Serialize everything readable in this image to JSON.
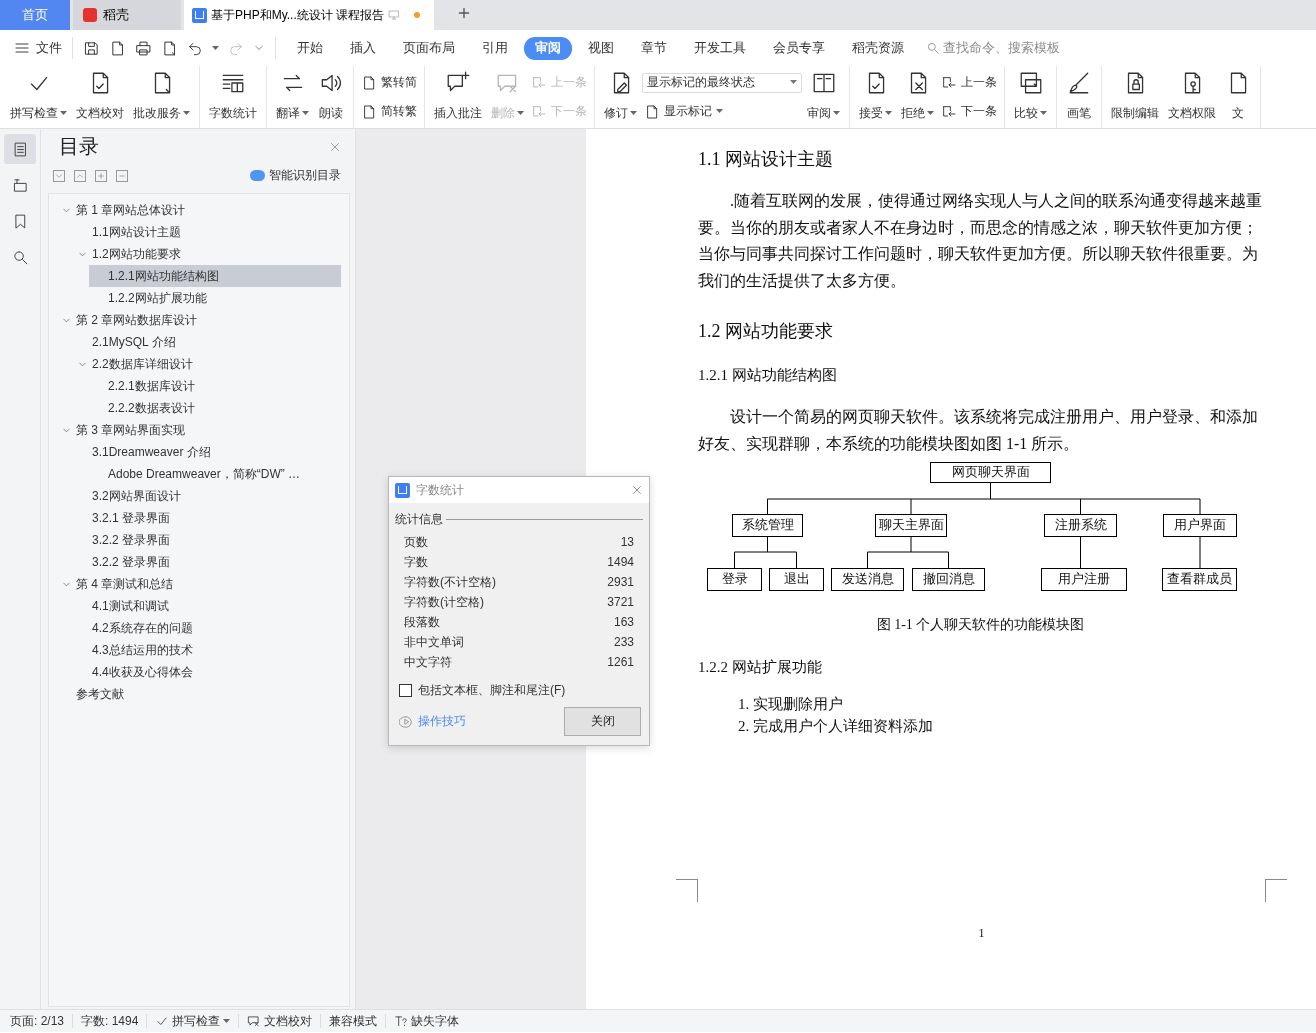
{
  "tabs": [
    {
      "kind": "home",
      "label": "首页",
      "selected": false
    },
    {
      "kind": "app",
      "label": "稻壳",
      "selected": false
    },
    {
      "kind": "document",
      "label": "基于PHP和My...统设计 课程报告",
      "selected": true,
      "modified": true
    }
  ],
  "menu": {
    "file": "文件",
    "tabs": [
      {
        "label": "开始",
        "selected": false
      },
      {
        "label": "插入",
        "selected": false
      },
      {
        "label": "页面布局",
        "selected": false
      },
      {
        "label": "引用",
        "selected": false
      },
      {
        "label": "审阅",
        "selected": true
      },
      {
        "label": "视图",
        "selected": false
      },
      {
        "label": "章节",
        "selected": false
      },
      {
        "label": "开发工具",
        "selected": false
      },
      {
        "label": "会员专享",
        "selected": false
      },
      {
        "label": "稻壳资源",
        "selected": false
      }
    ],
    "search": {
      "placeholder": "查找命令、搜索模板"
    }
  },
  "ribbon": {
    "groups": [
      {
        "items": [
          {
            "kind": "large",
            "label": "拼写检查",
            "menu": true,
            "disabled": false
          },
          {
            "kind": "large",
            "label": "文档校对",
            "menu": false,
            "disabled": false
          },
          {
            "kind": "large",
            "label": "批改服务",
            "menu": true,
            "disabled": false
          }
        ]
      },
      {
        "items": [
          {
            "kind": "large",
            "label": "字数统计",
            "menu": false,
            "disabled": false
          }
        ]
      },
      {
        "items": [
          {
            "kind": "large",
            "label": "翻译",
            "menu": true,
            "disabled": false
          },
          {
            "kind": "large",
            "label": "朗读",
            "menu": false,
            "disabled": false
          }
        ]
      },
      {
        "items": [
          {
            "kind": "stack",
            "items": [
              {
                "kind": "small",
                "label": "繁转简",
                "menu": false,
                "disabled": false
              },
              {
                "kind": "small",
                "label": "简转繁",
                "menu": false,
                "disabled": false
              }
            ]
          }
        ]
      },
      {
        "items": [
          {
            "kind": "large",
            "label": "插入批注",
            "menu": false,
            "disabled": false
          },
          {
            "kind": "large",
            "label": "删除",
            "menu": true,
            "disabled": true
          },
          {
            "kind": "stack",
            "items": [
              {
                "kind": "small",
                "label": "上一条",
                "menu": false,
                "disabled": true
              },
              {
                "kind": "small",
                "label": "下一条",
                "menu": false,
                "disabled": true
              }
            ]
          }
        ]
      },
      {
        "items": [
          {
            "kind": "large",
            "label": "修订",
            "menu": true,
            "disabled": false
          },
          {
            "kind": "stack",
            "items": [
              {
                "kind": "select",
                "value": "显示标记的最终状态"
              },
              {
                "kind": "small",
                "label": "显示标记",
                "menu": true,
                "disabled": false
              }
            ]
          },
          {
            "kind": "large",
            "label": "审阅",
            "menu": true,
            "disabled": false
          }
        ]
      },
      {
        "items": [
          {
            "kind": "large",
            "label": "接受",
            "menu": true,
            "disabled": false
          },
          {
            "kind": "large",
            "label": "拒绝",
            "menu": true,
            "disabled": false
          },
          {
            "kind": "stack",
            "items": [
              {
                "kind": "small",
                "label": "上一条",
                "menu": false,
                "disabled": false
              },
              {
                "kind": "small",
                "label": "下一条",
                "menu": false,
                "disabled": false
              }
            ]
          }
        ]
      },
      {
        "items": [
          {
            "kind": "large",
            "label": "比较",
            "menu": true,
            "disabled": false
          }
        ]
      },
      {
        "items": [
          {
            "kind": "large",
            "label": "画笔",
            "menu": false,
            "disabled": false
          }
        ]
      },
      {
        "items": [
          {
            "kind": "large",
            "label": "限制编辑",
            "menu": false,
            "disabled": false
          },
          {
            "kind": "large",
            "label": "文档权限",
            "menu": false,
            "disabled": false
          },
          {
            "kind": "large",
            "label": "文",
            "menu": false,
            "disabled": false
          }
        ]
      }
    ]
  },
  "side_rail": [
    {
      "selected": true
    },
    {
      "selected": false
    },
    {
      "selected": false
    },
    {
      "selected": false
    }
  ],
  "toc": {
    "title": "目录",
    "smart_button": "智能识别目录",
    "items": [
      {
        "label": "第 1 章网站总体设计",
        "expanded": true,
        "selected": false,
        "children": [
          {
            "label": "1.1网站设计主题",
            "expanded": false,
            "selected": false
          },
          {
            "label": "1.2网站功能要求",
            "expanded": true,
            "selected": false,
            "children": [
              {
                "label": "1.2.1网站功能结构图",
                "expanded": false,
                "selected": true
              },
              {
                "label": "1.2.2网站扩展功能",
                "expanded": false,
                "selected": false
              }
            ]
          }
        ]
      },
      {
        "label": "第 2 章网站数据库设计",
        "expanded": true,
        "selected": false,
        "children": [
          {
            "label": "2.1MySQL 介绍",
            "expanded": false,
            "selected": false
          },
          {
            "label": "2.2数据库详细设计",
            "expanded": true,
            "selected": false,
            "children": [
              {
                "label": "2.2.1数据库设计",
                "expanded": false,
                "selected": false
              },
              {
                "label": "2.2.2数据表设计",
                "expanded": false,
                "selected": false
              }
            ]
          }
        ]
      },
      {
        "label": "第 3 章网站界面实现",
        "expanded": true,
        "selected": false,
        "children": [
          {
            "label": "3.1Dreamweaver 介绍",
            "expanded": false,
            "selected": false,
            "children": [
              {
                "label": "Adobe Dreamweaver，简称“DW” …",
                "expanded": false,
                "selected": false
              }
            ]
          },
          {
            "label": "3.2网站界面设计",
            "expanded": false,
            "selected": false
          },
          {
            "label": "3.2.1  登录界面",
            "expanded": false,
            "selected": false
          },
          {
            "label": "3.2.2  登录界面",
            "expanded": false,
            "selected": false
          },
          {
            "label": "3.2.2  登录界面",
            "expanded": false,
            "selected": false
          }
        ]
      },
      {
        "label": "第 4 章测试和总结",
        "expanded": true,
        "selected": false,
        "children": [
          {
            "label": "4.1测试和调试",
            "expanded": false,
            "selected": false
          },
          {
            "label": "4.2系统存在的问题",
            "expanded": false,
            "selected": false
          },
          {
            "label": "4.3总结运用的技术",
            "expanded": false,
            "selected": false
          },
          {
            "label": "4.4收获及心得体会",
            "expanded": false,
            "selected": false
          }
        ]
      },
      {
        "label": "参考文献",
        "expanded": false,
        "selected": false
      }
    ]
  },
  "document": {
    "blocks": [
      {
        "kind": "heading_large",
        "text": "1.1  网站设计主题"
      },
      {
        "kind": "paragraph",
        "text": ".随着互联网的发展，使得通过网络实现人与人之间的联系沟通变得越来越重要。当你的朋友或者家人不在身边时，而思念的情感之浓，聊天软件更加方便；当你与同事共同探讨工作问题时，聊天软件更加方便。所以聊天软件很重要。为我们的生活提供了太多方便。"
      },
      {
        "kind": "heading_large",
        "text": "1.2  网站功能要求"
      },
      {
        "kind": "heading_small",
        "text": "1.2.1  网站功能结构图"
      },
      {
        "kind": "paragraph",
        "text": "设计一个简易的网页聊天软件。该系统将完成注册用户、用户登录、和添加好友、实现群聊，本系统的功能模块图如图 1-1 所示。"
      },
      {
        "kind": "diagram",
        "root": {
          "label": "网页聊天界面",
          "children": [
            {
              "label": "系统管理",
              "children": [
                {
                  "label": "登录"
                },
                {
                  "label": "退出"
                }
              ]
            },
            {
              "label": "聊天主界面",
              "children": [
                {
                  "label": "发送消息"
                },
                {
                  "label": "撤回消息"
                }
              ]
            },
            {
              "label": "注册系统",
              "children": [
                {
                  "label": "用户注册"
                }
              ]
            },
            {
              "label": "用户界面",
              "children": [
                {
                  "label": "查看群成员"
                }
              ]
            }
          ]
        }
      },
      {
        "kind": "caption",
        "text": "图 1-1  个人聊天软件的功能模块图"
      },
      {
        "kind": "heading_small",
        "text": "1.2.2  网站扩展功能"
      },
      {
        "kind": "list",
        "items": [
          "1. 实现删除用户",
          "2. 完成用户个人详细资料添加"
        ]
      }
    ],
    "page_number": "1"
  },
  "dialog": {
    "title": "字数统计",
    "section": "统计信息",
    "stats": [
      {
        "label": "页数",
        "value": "13"
      },
      {
        "label": "字数",
        "value": "1494"
      },
      {
        "label": "字符数(不计空格)",
        "value": "2931"
      },
      {
        "label": "字符数(计空格)",
        "value": "3721"
      },
      {
        "label": "段落数",
        "value": "163"
      },
      {
        "label": "非中文单词",
        "value": "233"
      },
      {
        "label": "中文字符",
        "value": "1261"
      }
    ],
    "checkbox": {
      "label": "包括文本框、脚注和尾注(F)",
      "checked": false
    },
    "tips": "操作技巧",
    "close": "关闭"
  },
  "status_bar": {
    "page": "页面: 2/13",
    "words": "字数: 1494",
    "spellcheck": "拼写检查",
    "proofread": "文档校对",
    "compat": "兼容模式",
    "fonts": "缺失字体"
  }
}
